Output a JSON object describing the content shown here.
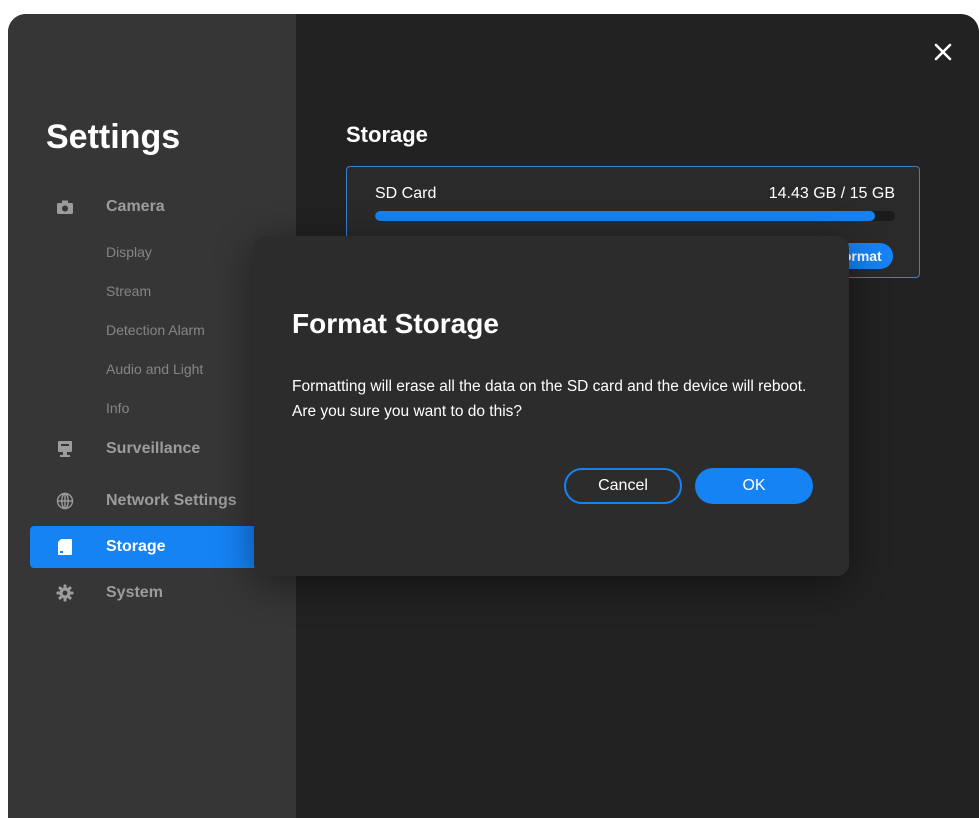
{
  "sidebar": {
    "title": "Settings",
    "items": [
      {
        "label": "Camera",
        "icon": "camera-icon"
      },
      {
        "label": "Surveillance",
        "icon": "monitor-icon"
      },
      {
        "label": "Network Settings",
        "icon": "globe-icon"
      },
      {
        "label": "Storage",
        "icon": "sd-card-icon",
        "active": true
      },
      {
        "label": "System",
        "icon": "gear-icon"
      }
    ],
    "camera_subitems": [
      "Display",
      "Stream",
      "Detection Alarm",
      "Audio and Light",
      "Info"
    ]
  },
  "main": {
    "title": "Storage",
    "card": {
      "name": "SD Card",
      "size_text": "14.43 GB / 15 GB",
      "used_fraction": 0.962,
      "format_label": "Format"
    }
  },
  "dialog": {
    "title": "Format Storage",
    "message": "Formatting will erase all the data on the SD card and the device will reboot. Are you sure you want to do this?",
    "cancel_label": "Cancel",
    "ok_label": "OK"
  },
  "colors": {
    "accent": "#1683f5",
    "sidebar_bg": "#363636",
    "main_bg": "#222222",
    "dialog_bg": "#2c2c2c"
  }
}
